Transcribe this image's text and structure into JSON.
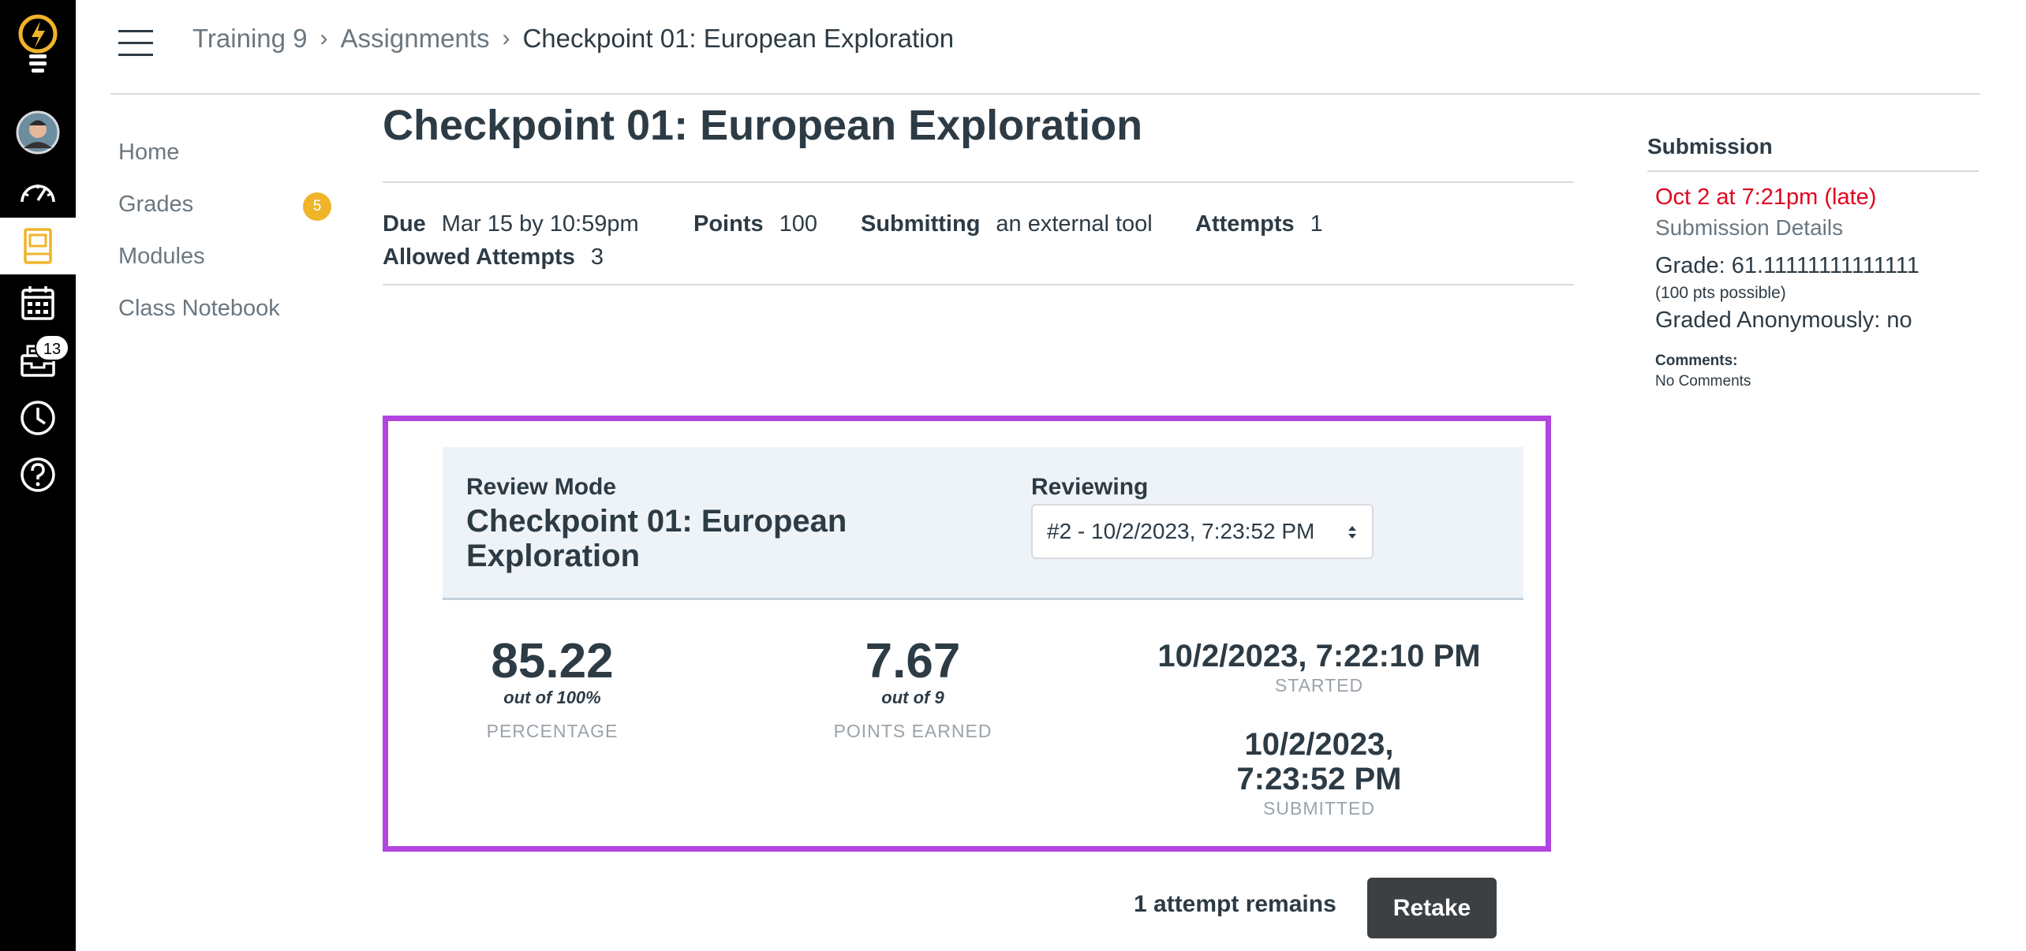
{
  "global_nav": {
    "inbox_badge": "13",
    "colors": {
      "background": "#000000",
      "logo": "#f0b429",
      "active_icon": "#f0b429"
    }
  },
  "header": {
    "breadcrumbs": [
      "Training 9",
      "Assignments",
      "Checkpoint 01: European Exploration"
    ]
  },
  "course_nav": {
    "items": [
      {
        "label": "Home"
      },
      {
        "label": "Grades",
        "badge": "5"
      },
      {
        "label": "Modules"
      },
      {
        "label": "Class Notebook"
      }
    ]
  },
  "assignment": {
    "title": "Checkpoint 01: European Exploration",
    "due_label": "Due",
    "due_value": "Mar 15 by 10:59pm",
    "points_label": "Points",
    "points_value": "100",
    "submitting_label": "Submitting",
    "submitting_value": "an external tool",
    "attempts_label": "Attempts",
    "attempts_value": "1",
    "allowed_label": "Allowed Attempts",
    "allowed_value": "3"
  },
  "review": {
    "mode_label": "Review Mode",
    "title": "Checkpoint 01: European Exploration",
    "reviewing_label": "Reviewing",
    "reviewing_selected": "#2 - 10/2/2023, 7:23:52 PM",
    "percentage": "85.22",
    "percentage_sub": "out of 100%",
    "percentage_label": "PERCENTAGE",
    "points": "7.67",
    "points_sub": "out of 9",
    "points_label": "POINTS EARNED",
    "started": "10/2/2023, 7:22:10 PM",
    "started_label": "STARTED",
    "submitted": "10/2/2023, 7:23:52 PM",
    "submitted_label": "SUBMITTED",
    "attempts_remaining": "1 attempt remains",
    "retake_label": "Retake",
    "frame_color": "#b244e0"
  },
  "sidebar": {
    "title": "Submission",
    "date": "Oct 2 at 7:21pm (late)",
    "details_link": "Submission Details",
    "grade": "Grade: 61.11111111111111",
    "possible": "(100 pts possible)",
    "anonymous": "Graded Anonymously: no",
    "comments_label": "Comments:",
    "comments": "No Comments",
    "late_color": "#e0061f"
  }
}
